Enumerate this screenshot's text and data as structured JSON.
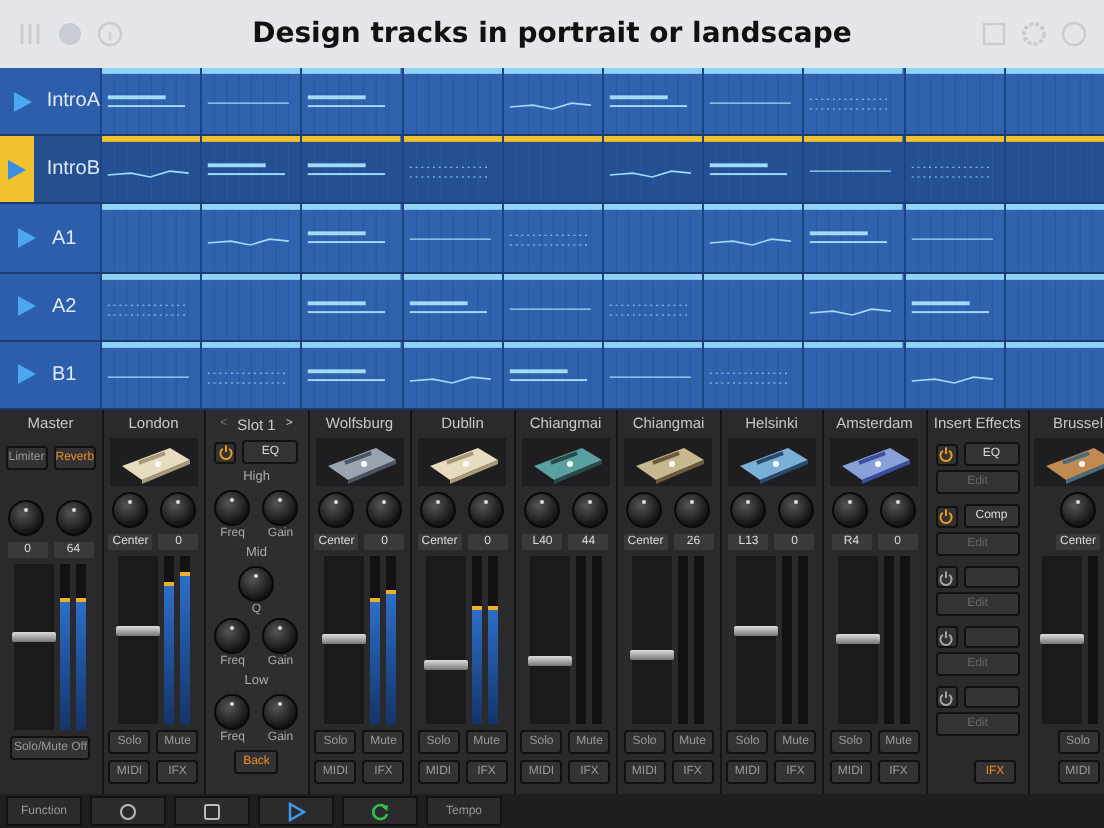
{
  "headline": "Design tracks in portrait or landscape",
  "tracks": [
    {
      "name": "IntroA",
      "selected": false
    },
    {
      "name": "IntroB",
      "selected": true
    },
    {
      "name": "A1",
      "selected": false
    },
    {
      "name": "A2",
      "selected": false
    },
    {
      "name": "B1",
      "selected": false
    }
  ],
  "mixer": [
    {
      "kind": "master",
      "name": "Master",
      "buttons": [
        {
          "label": "Limiter",
          "on": false
        },
        {
          "label": "Reverb",
          "on": true
        }
      ],
      "readings": [
        "0",
        "64"
      ],
      "level": 0.55,
      "meters": [
        {
          "level": 0.8
        },
        {
          "level": 0.8
        }
      ],
      "footer": "Solo/Mute Off"
    },
    {
      "kind": "instrument",
      "name": "London",
      "pan": "Center",
      "value": "0",
      "level": 0.55,
      "meters": [
        {
          "level": 0.85
        },
        {
          "level": 0.9
        }
      ],
      "solo": "Solo",
      "mute": "Mute",
      "midi": "MIDI",
      "ifx": "IFX"
    },
    {
      "kind": "eq",
      "name": "Slot 1",
      "prev": "<",
      "next": ">",
      "effect": "EQ",
      "on": true,
      "bands": [
        {
          "name": "High",
          "knobs": [
            "Freq",
            "Gain"
          ]
        },
        {
          "name": "Mid",
          "knobs": [
            "Q",
            "Freq",
            "Gain"
          ]
        },
        {
          "name": "Low",
          "knobs": [
            "Freq",
            "Gain"
          ]
        }
      ],
      "back": "Back"
    },
    {
      "kind": "instrument",
      "name": "Wolfsburg",
      "pan": "Center",
      "value": "0",
      "level": 0.5,
      "meters": [
        {
          "level": 0.75
        },
        {
          "level": 0.8
        }
      ],
      "solo": "Solo",
      "mute": "Mute",
      "midi": "MIDI",
      "ifx": "IFX"
    },
    {
      "kind": "instrument",
      "name": "Dublin",
      "pan": "Center",
      "value": "0",
      "level": 0.35,
      "meters": [
        {
          "level": 0.7
        },
        {
          "level": 0.7
        }
      ],
      "solo": "Solo",
      "mute": "Mute",
      "midi": "MIDI",
      "ifx": "IFX"
    },
    {
      "kind": "instrument",
      "name": "Chiangmai",
      "pan": "L40",
      "value": "44",
      "level": 0.37,
      "solo": "Solo",
      "mute": "Mute",
      "midi": "MIDI",
      "ifx": "IFX"
    },
    {
      "kind": "instrument",
      "name": "Chiangmai",
      "pan": "Center",
      "value": "26",
      "level": 0.4,
      "solo": "Solo",
      "mute": "Mute",
      "midi": "MIDI",
      "ifx": "IFX"
    },
    {
      "kind": "instrument",
      "name": "Helsinki",
      "pan": "L13",
      "value": "0",
      "level": 0.55,
      "solo": "Solo",
      "mute": "Mute",
      "midi": "MIDI",
      "ifx": "IFX"
    },
    {
      "kind": "instrument",
      "name": "Amsterdam",
      "pan": "R4",
      "value": "0",
      "level": 0.5,
      "solo": "Solo",
      "mute": "Mute",
      "midi": "MIDI",
      "ifx": "IFX"
    },
    {
      "kind": "inserts",
      "name": "Insert Effects",
      "slots": [
        {
          "effect": "EQ",
          "on": true,
          "edit": "Edit"
        },
        {
          "effect": "Comp",
          "on": true,
          "edit": "Edit"
        },
        {
          "on": false,
          "edit": "Edit"
        },
        {
          "on": false,
          "edit": "Edit"
        },
        {
          "on": false,
          "edit": "Edit"
        }
      ],
      "ifx": "IFX"
    },
    {
      "kind": "instrument",
      "name": "Brussel",
      "pan": "Center",
      "level": 0.5,
      "solo": "Solo",
      "midi": "MIDI"
    }
  ],
  "transport": [
    {
      "kind": "text",
      "label": "Function"
    },
    {
      "kind": "record"
    },
    {
      "kind": "stop"
    },
    {
      "kind": "play"
    },
    {
      "kind": "loop"
    },
    {
      "kind": "text",
      "label": "Tempo"
    }
  ]
}
